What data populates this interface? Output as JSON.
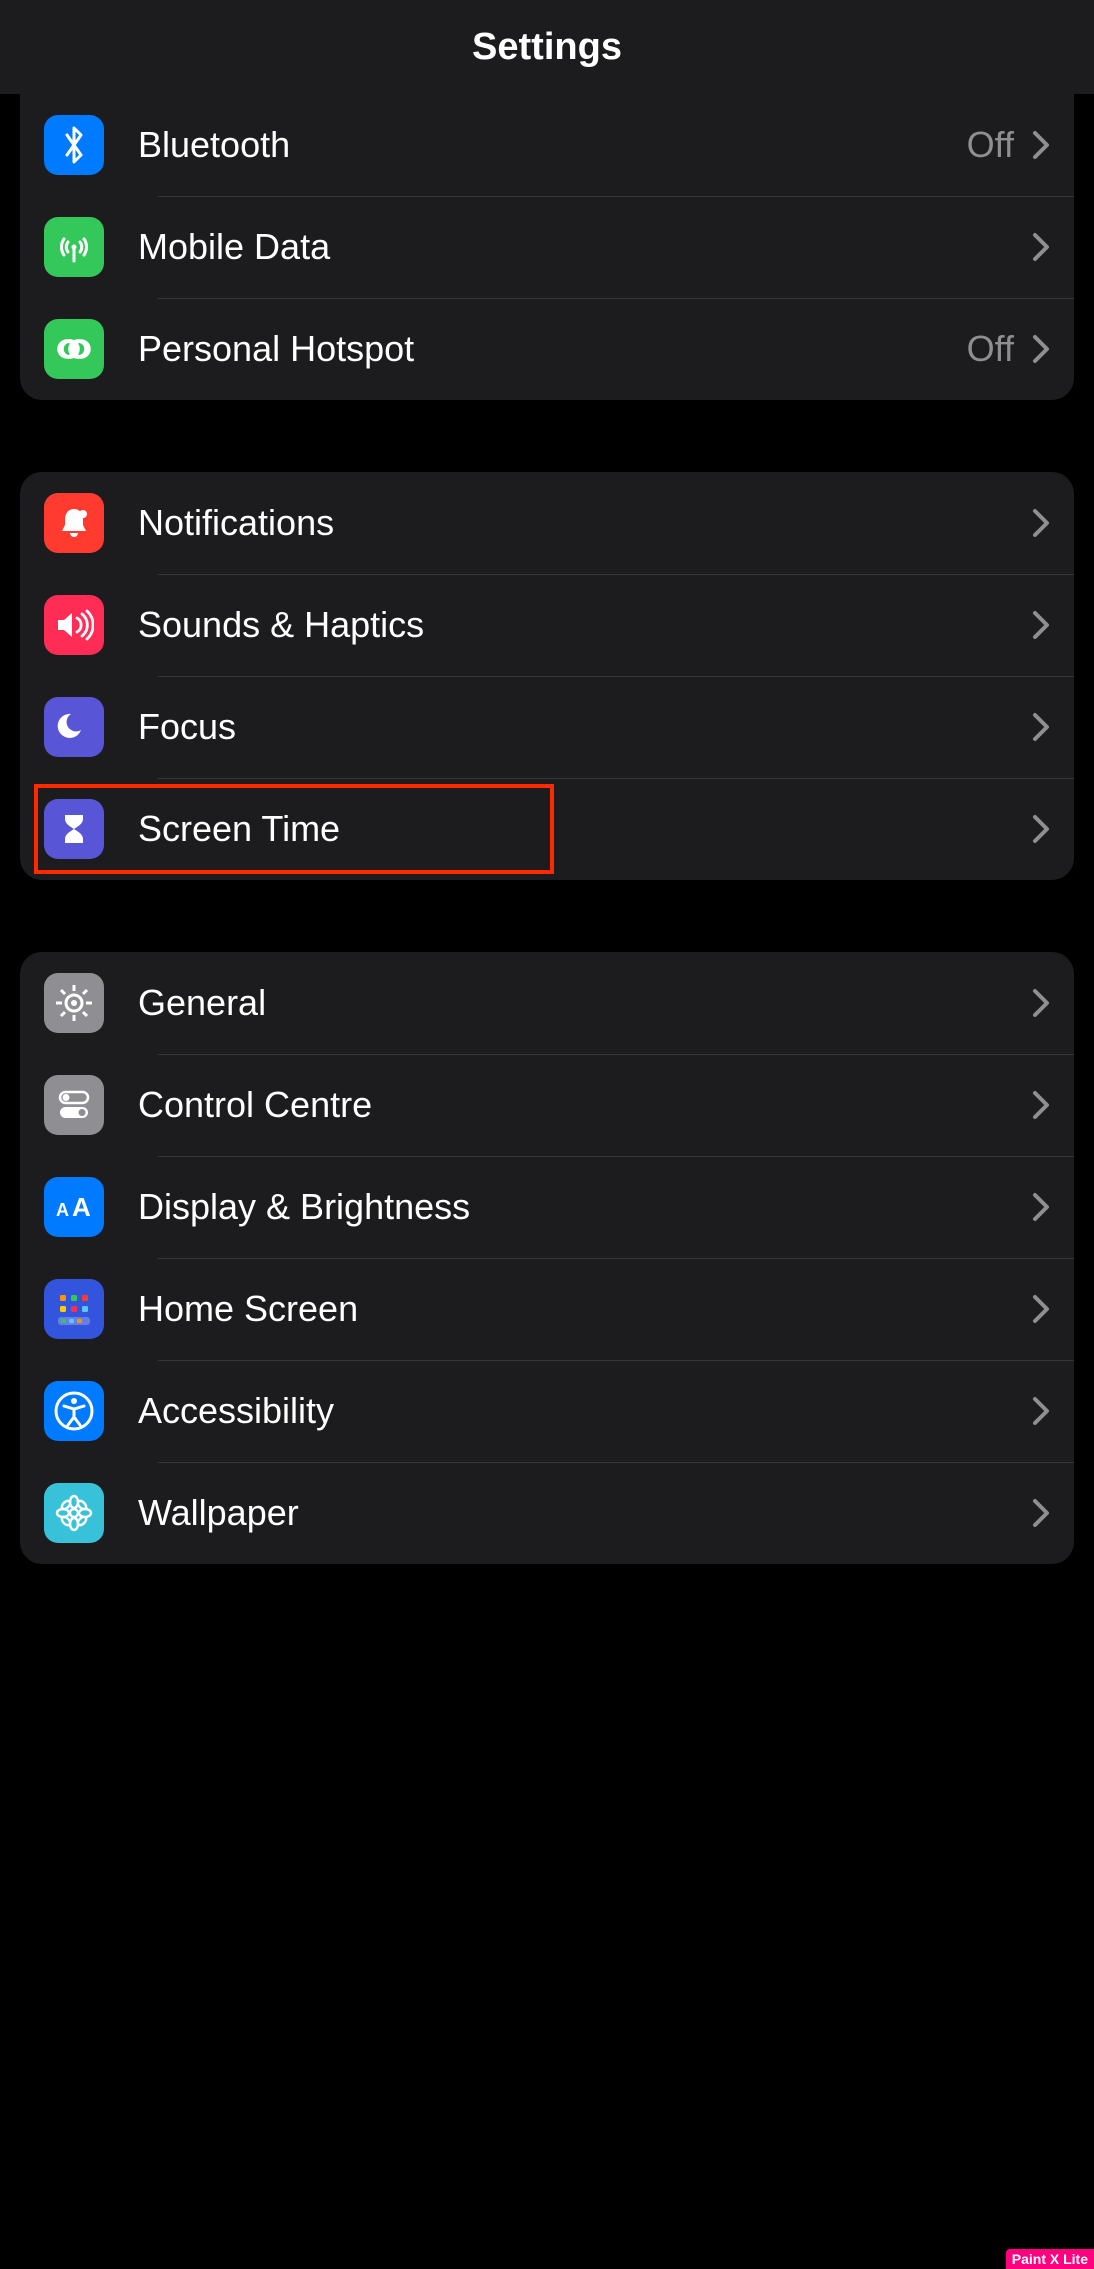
{
  "header": {
    "title": "Settings"
  },
  "groups": [
    {
      "id": "connectivity",
      "rows": [
        {
          "id": "bluetooth",
          "label": "Bluetooth",
          "value": "Off",
          "icon": "bluetooth",
          "icon_bg": "#007aff"
        },
        {
          "id": "mobile-data",
          "label": "Mobile Data",
          "value": "",
          "icon": "antenna",
          "icon_bg": "#34c759"
        },
        {
          "id": "personal-hotspot",
          "label": "Personal Hotspot",
          "value": "Off",
          "icon": "link",
          "icon_bg": "#34c759"
        }
      ]
    },
    {
      "id": "attention",
      "rows": [
        {
          "id": "notifications",
          "label": "Notifications",
          "value": "",
          "icon": "bell",
          "icon_bg": "#ff3b30"
        },
        {
          "id": "sounds-haptics",
          "label": "Sounds & Haptics",
          "value": "",
          "icon": "speaker",
          "icon_bg": "#ff2d55"
        },
        {
          "id": "focus",
          "label": "Focus",
          "value": "",
          "icon": "moon",
          "icon_bg": "#5856d6"
        },
        {
          "id": "screen-time",
          "label": "Screen Time",
          "value": "",
          "icon": "hourglass",
          "icon_bg": "#5856d6",
          "highlighted": true
        }
      ]
    },
    {
      "id": "system",
      "rows": [
        {
          "id": "general",
          "label": "General",
          "value": "",
          "icon": "gear",
          "icon_bg": "#8e8e93"
        },
        {
          "id": "control-centre",
          "label": "Control Centre",
          "value": "",
          "icon": "switches",
          "icon_bg": "#8e8e93"
        },
        {
          "id": "display-brightness",
          "label": "Display & Brightness",
          "value": "",
          "icon": "aa",
          "icon_bg": "#007aff"
        },
        {
          "id": "home-screen",
          "label": "Home Screen",
          "value": "",
          "icon": "grid",
          "icon_bg": "#3355dd"
        },
        {
          "id": "accessibility",
          "label": "Accessibility",
          "value": "",
          "icon": "accessibility",
          "icon_bg": "#007aff"
        },
        {
          "id": "wallpaper",
          "label": "Wallpaper",
          "value": "",
          "icon": "flower",
          "icon_bg": "#37c2d9"
        }
      ]
    }
  ],
  "highlight": {
    "target_row": "screen-time"
  },
  "watermark": "Paint X Lite"
}
